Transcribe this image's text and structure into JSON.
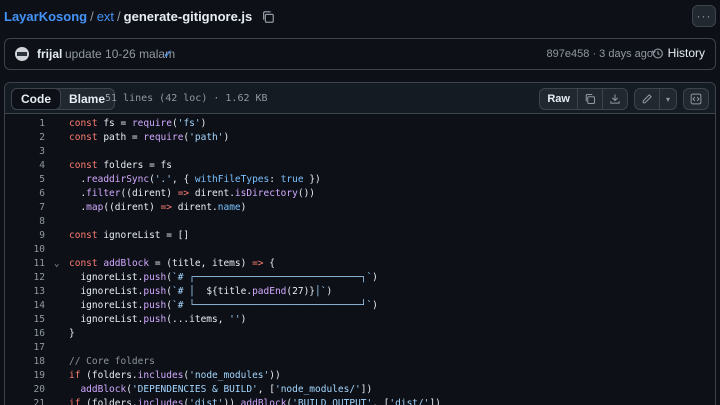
{
  "breadcrumb": {
    "repo": "LayarKosong",
    "sep": "/",
    "folder": "ext",
    "file": "generate-gitignore.js"
  },
  "commit": {
    "author": "frijal",
    "message": "update 10-26 malam",
    "status_icon": "check-icon",
    "hash": "897e458",
    "dot": "·",
    "when": "3 days ago",
    "history_label": "History"
  },
  "file_header": {
    "tabs": [
      "Code",
      "Blame"
    ],
    "active_tab": "Code",
    "info": "51 lines (42 loc) · 1.62 KB",
    "raw_label": "Raw"
  },
  "colors": {
    "background": "#0d1117",
    "link": "#4493f8",
    "keyword": "#ff7b72",
    "function": "#d2a8ff",
    "string": "#a5d6ff",
    "comment": "#8b949e"
  },
  "code_lines": [
    {
      "n": "1",
      "fold": "",
      "tokens": [
        [
          "k",
          "const"
        ],
        [
          "t",
          " fs = "
        ],
        [
          "f",
          "require"
        ],
        [
          "t",
          "("
        ],
        [
          "s",
          "'fs'"
        ],
        [
          "t",
          ")"
        ]
      ]
    },
    {
      "n": "2",
      "fold": "",
      "tokens": [
        [
          "k",
          "const"
        ],
        [
          "t",
          " path = "
        ],
        [
          "f",
          "require"
        ],
        [
          "t",
          "("
        ],
        [
          "s",
          "'path'"
        ],
        [
          "t",
          ")"
        ]
      ]
    },
    {
      "n": "3",
      "fold": "",
      "tokens": []
    },
    {
      "n": "4",
      "fold": "",
      "tokens": [
        [
          "k",
          "const"
        ],
        [
          "t",
          " folders = fs"
        ]
      ]
    },
    {
      "n": "5",
      "fold": "",
      "tokens": [
        [
          "t",
          "  ."
        ],
        [
          "f",
          "readdirSync"
        ],
        [
          "t",
          "("
        ],
        [
          "s",
          "'.'"
        ],
        [
          "t",
          ", { "
        ],
        [
          "p",
          "withFileTypes"
        ],
        [
          "t",
          ": "
        ],
        [
          "p",
          "true"
        ],
        [
          "t",
          " })"
        ]
      ]
    },
    {
      "n": "6",
      "fold": "",
      "tokens": [
        [
          "t",
          "  ."
        ],
        [
          "f",
          "filter"
        ],
        [
          "t",
          "((dirent) "
        ],
        [
          "k",
          "=>"
        ],
        [
          "t",
          " dirent."
        ],
        [
          "f",
          "isDirectory"
        ],
        [
          "t",
          "())"
        ]
      ]
    },
    {
      "n": "7",
      "fold": "",
      "tokens": [
        [
          "t",
          "  ."
        ],
        [
          "f",
          "map"
        ],
        [
          "t",
          "((dirent) "
        ],
        [
          "k",
          "=>"
        ],
        [
          "t",
          " dirent."
        ],
        [
          "p",
          "name"
        ],
        [
          "t",
          ")"
        ]
      ]
    },
    {
      "n": "8",
      "fold": "",
      "tokens": []
    },
    {
      "n": "9",
      "fold": "",
      "tokens": [
        [
          "k",
          "const"
        ],
        [
          "t",
          " ignoreList = []"
        ]
      ]
    },
    {
      "n": "10",
      "fold": "",
      "tokens": []
    },
    {
      "n": "11",
      "fold": "⌄",
      "tokens": [
        [
          "k",
          "const"
        ],
        [
          "t",
          " "
        ],
        [
          "f",
          "addBlock"
        ],
        [
          "t",
          " = (title, items) "
        ],
        [
          "k",
          "=>"
        ],
        [
          "t",
          " {"
        ]
      ]
    },
    {
      "n": "12",
      "fold": "",
      "tokens": [
        [
          "t",
          "  ignoreList."
        ],
        [
          "f",
          "push"
        ],
        [
          "t",
          "("
        ],
        [
          "s",
          "`# ┌─────────────────────────────┐`"
        ],
        [
          "t",
          ")"
        ]
      ]
    },
    {
      "n": "13",
      "fold": "",
      "tokens": [
        [
          "t",
          "  ignoreList."
        ],
        [
          "f",
          "push"
        ],
        [
          "t",
          "("
        ],
        [
          "s",
          "`# │  "
        ],
        [
          "t",
          "${title."
        ],
        [
          "f",
          "padEnd"
        ],
        [
          "t",
          "(27)}"
        ],
        [
          "s",
          "│`"
        ],
        [
          "t",
          ")"
        ]
      ]
    },
    {
      "n": "14",
      "fold": "",
      "tokens": [
        [
          "t",
          "  ignoreList."
        ],
        [
          "f",
          "push"
        ],
        [
          "t",
          "("
        ],
        [
          "s",
          "`# └─────────────────────────────┘`"
        ],
        [
          "t",
          ")"
        ]
      ]
    },
    {
      "n": "15",
      "fold": "",
      "tokens": [
        [
          "t",
          "  ignoreList."
        ],
        [
          "f",
          "push"
        ],
        [
          "t",
          "(...items, "
        ],
        [
          "s",
          "''"
        ],
        [
          "t",
          ")"
        ]
      ]
    },
    {
      "n": "16",
      "fold": "",
      "tokens": [
        [
          "t",
          "}"
        ]
      ]
    },
    {
      "n": "17",
      "fold": "",
      "tokens": []
    },
    {
      "n": "18",
      "fold": "",
      "tokens": [
        [
          "c",
          "// Core folders"
        ]
      ]
    },
    {
      "n": "19",
      "fold": "",
      "tokens": [
        [
          "k",
          "if"
        ],
        [
          "t",
          " (folders."
        ],
        [
          "f",
          "includes"
        ],
        [
          "t",
          "("
        ],
        [
          "s",
          "'node_modules'"
        ],
        [
          "t",
          "))"
        ]
      ]
    },
    {
      "n": "20",
      "fold": "",
      "tokens": [
        [
          "t",
          "  "
        ],
        [
          "f",
          "addBlock"
        ],
        [
          "t",
          "("
        ],
        [
          "s",
          "'DEPENDENCIES & BUILD'"
        ],
        [
          "t",
          ", ["
        ],
        [
          "s",
          "'node_modules/'"
        ],
        [
          "t",
          "])"
        ]
      ]
    },
    {
      "n": "21",
      "fold": "",
      "tokens": [
        [
          "k",
          "if"
        ],
        [
          "t",
          " (folders."
        ],
        [
          "f",
          "includes"
        ],
        [
          "t",
          "("
        ],
        [
          "s",
          "'dist'"
        ],
        [
          "t",
          ")) "
        ],
        [
          "f",
          "addBlock"
        ],
        [
          "t",
          "("
        ],
        [
          "s",
          "'BUILD OUTPUT'"
        ],
        [
          "t",
          ", ["
        ],
        [
          "s",
          "'dist/'"
        ],
        [
          "t",
          "])"
        ]
      ]
    }
  ]
}
